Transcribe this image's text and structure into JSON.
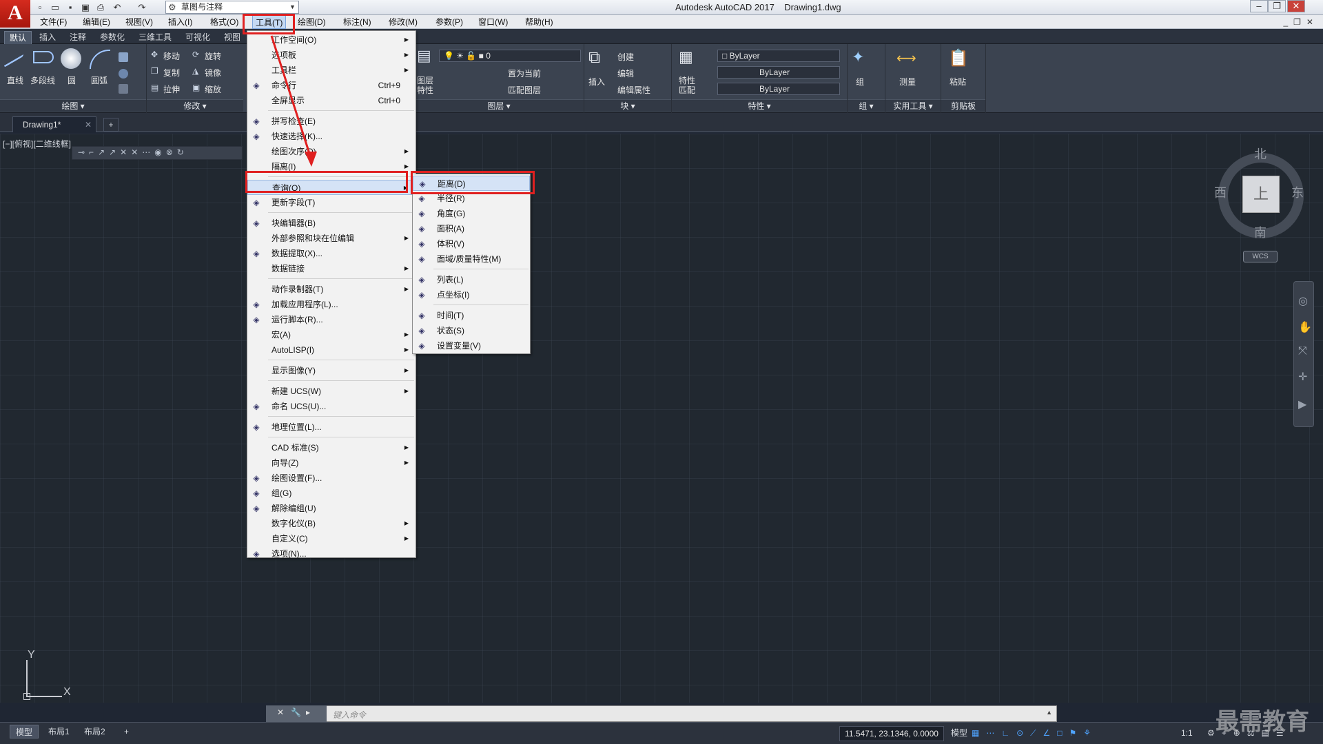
{
  "app": {
    "title": "Autodesk AutoCAD 2017",
    "document": "Drawing1.dwg",
    "logo_letter": "A",
    "workspace": "草图与注释"
  },
  "menubar": [
    "文件(F)",
    "编辑(E)",
    "视图(V)",
    "插入(I)",
    "格式(O)",
    "工具(T)",
    "绘图(D)",
    "标注(N)",
    "修改(M)",
    "参数(P)",
    "窗口(W)",
    "帮助(H)"
  ],
  "ribbon_tabs": [
    "默认",
    "插入",
    "注释",
    "参数化",
    "三维工具",
    "可视化",
    "视图"
  ],
  "ribbon": {
    "draw": {
      "title": "绘图",
      "line": "直线",
      "polyline": "多段线",
      "circle": "圆",
      "arc": "圆弧"
    },
    "modify": {
      "title": "修改",
      "move": "移动",
      "rotate": "旋转",
      "copy": "复制",
      "mirror": "镜像",
      "stretch": "拉伸",
      "scale": "缩放"
    },
    "layer": {
      "title": "图层",
      "props": "图层\n特性",
      "layer_name": "0",
      "set_current": "置为当前",
      "match_layer": "匹配图层"
    },
    "block": {
      "title": "块",
      "insert": "插入",
      "create": "创建",
      "edit": "编辑",
      "edit_attr": "编辑属性"
    },
    "properties": {
      "title": "特性",
      "match": "特性\n匹配",
      "color": "ByLayer",
      "linetype": "ByLayer",
      "lineweight": "ByLayer"
    },
    "group": {
      "title": "组",
      "group": "组"
    },
    "utilities": {
      "title": "实用工具",
      "measure": "测量"
    },
    "clipboard": {
      "title": "剪贴板",
      "paste": "粘贴"
    }
  },
  "doc_tab": "Drawing1*",
  "viewport_label": "[−][俯视][二维线框]",
  "tools_menu": [
    {
      "label": "工作空间(O)",
      "arrow": true
    },
    {
      "label": "选项板",
      "arrow": true
    },
    {
      "label": "工具栏",
      "arrow": true
    },
    {
      "label": "命令行",
      "shortcut": "Ctrl+9",
      "icon": "command-line-icon"
    },
    {
      "label": "全屏显示",
      "shortcut": "Ctrl+0"
    },
    {
      "sep": true
    },
    {
      "label": "拼写检查(E)",
      "icon": "spellcheck-icon"
    },
    {
      "label": "快速选择(K)...",
      "icon": "quick-select-icon"
    },
    {
      "label": "绘图次序(D)",
      "arrow": true
    },
    {
      "label": "隔离(I)",
      "arrow": true
    },
    {
      "sep": true
    },
    {
      "label": "查询(Q)",
      "arrow": true,
      "highlight": true
    },
    {
      "label": "更新字段(T)",
      "icon": "update-field-icon"
    },
    {
      "sep": true
    },
    {
      "label": "块编辑器(B)",
      "icon": "block-editor-icon"
    },
    {
      "label": "外部参照和块在位编辑",
      "arrow": true
    },
    {
      "label": "数据提取(X)...",
      "icon": "data-extract-icon"
    },
    {
      "label": "数据链接",
      "arrow": true
    },
    {
      "sep": true
    },
    {
      "label": "动作录制器(T)",
      "arrow": true
    },
    {
      "label": "加载应用程序(L)...",
      "icon": "load-app-icon"
    },
    {
      "label": "运行脚本(R)...",
      "icon": "run-script-icon"
    },
    {
      "label": "宏(A)",
      "arrow": true
    },
    {
      "label": "AutoLISP(I)",
      "arrow": true
    },
    {
      "sep": true
    },
    {
      "label": "显示图像(Y)",
      "arrow": true
    },
    {
      "sep": true
    },
    {
      "label": "新建 UCS(W)",
      "arrow": true
    },
    {
      "label": "命名 UCS(U)...",
      "icon": "named-ucs-icon"
    },
    {
      "sep": true
    },
    {
      "label": "地理位置(L)...",
      "icon": "geolocation-icon"
    },
    {
      "sep": true
    },
    {
      "label": "CAD 标准(S)",
      "arrow": true
    },
    {
      "label": "向导(Z)",
      "arrow": true
    },
    {
      "label": "绘图设置(F)...",
      "icon": "drafting-settings-icon"
    },
    {
      "label": "组(G)",
      "icon": "group-icon"
    },
    {
      "label": "解除编组(U)",
      "icon": "ungroup-icon"
    },
    {
      "label": "数字化仪(B)",
      "arrow": true
    },
    {
      "label": "自定义(C)",
      "arrow": true
    },
    {
      "label": "选项(N)...",
      "icon": "options-icon"
    }
  ],
  "inquiry_menu": [
    {
      "label": "距离(D)",
      "highlight": true,
      "icon": "distance-icon"
    },
    {
      "label": "半径(R)",
      "icon": "radius-icon"
    },
    {
      "label": "角度(G)",
      "icon": "angle-icon"
    },
    {
      "label": "面积(A)",
      "icon": "area-icon"
    },
    {
      "label": "体积(V)",
      "icon": "volume-icon"
    },
    {
      "label": "面域/质量特性(M)",
      "icon": "mass-props-icon"
    },
    {
      "sep": true
    },
    {
      "label": "列表(L)",
      "icon": "list-icon"
    },
    {
      "label": "点坐标(I)",
      "icon": "id-point-icon"
    },
    {
      "sep": true
    },
    {
      "label": "时间(T)",
      "icon": "time-icon"
    },
    {
      "label": "状态(S)",
      "icon": "status-icon"
    },
    {
      "label": "设置变量(V)",
      "icon": "setvar-icon"
    }
  ],
  "viewcube": {
    "north": "北",
    "south": "南",
    "east": "东",
    "west": "西",
    "top": "上",
    "wcs": "WCS"
  },
  "ucs": {
    "x": "X",
    "y": "Y"
  },
  "command_placeholder": "键入命令",
  "layouts": [
    "模型",
    "布局1",
    "布局2"
  ],
  "status": {
    "coords": "11.5471, 23.1346, 0.0000",
    "model": "模型",
    "scale": "1:1"
  },
  "watermark": "最需教育"
}
